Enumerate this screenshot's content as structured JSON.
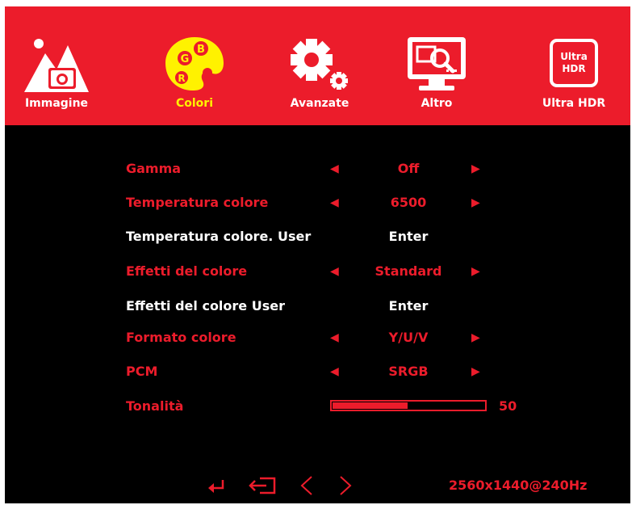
{
  "header": {
    "tabs": [
      {
        "label": "Immagine",
        "icon": "image-icon",
        "active": false
      },
      {
        "label": "Colori",
        "icon": "palette-icon",
        "active": true
      },
      {
        "label": "Avanzate",
        "icon": "gear-icon",
        "active": false
      },
      {
        "label": "Altro",
        "icon": "monitor-search-icon",
        "active": false
      },
      {
        "label": "Ultra HDR",
        "icon": "ultra-hdr-icon",
        "active": false,
        "badge": [
          "Ultra",
          "HDR"
        ]
      }
    ],
    "palette_letters": [
      "G",
      "B",
      "R"
    ]
  },
  "settings": {
    "gamma": {
      "label": "Gamma",
      "value": "Off"
    },
    "color_temp": {
      "label": "Temperatura colore",
      "value": "6500"
    },
    "color_temp_user": {
      "label": "Temperatura colore. User",
      "value": "Enter"
    },
    "color_effects": {
      "label": "Effetti del colore",
      "value": "Standard"
    },
    "color_effects_user": {
      "label": "Effetti del colore User",
      "value": "Enter"
    },
    "color_format": {
      "label": "Formato colore",
      "value": "Y/U/V"
    },
    "pcm": {
      "label": "PCM",
      "value": "SRGB"
    },
    "hue": {
      "label": "Tonalità",
      "value": "50",
      "level_fraction": 0.5
    }
  },
  "footer": {
    "resolution": "2560x1440@240Hz",
    "nav_icons": [
      "enter-icon",
      "exit-icon",
      "left-icon",
      "right-icon"
    ]
  },
  "colors": {
    "accent": "#ec1c2b",
    "active_tab": "#fff200",
    "text": "#ffffff",
    "background": "#000000"
  }
}
